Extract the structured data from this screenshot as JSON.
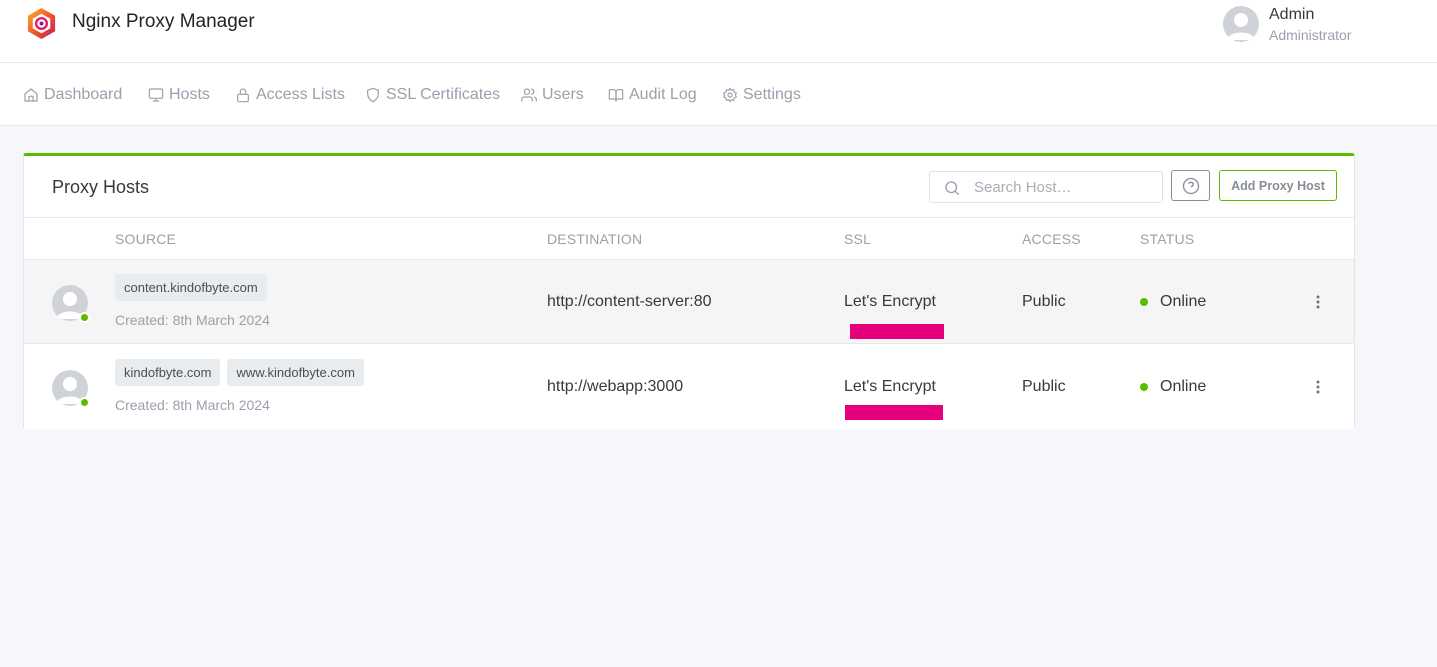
{
  "header": {
    "app_title": "Nginx Proxy Manager",
    "logo_icon": "nginx-proxy-manager-logo",
    "user": {
      "name": "Admin",
      "role": "Administrator"
    }
  },
  "nav": {
    "items": [
      {
        "label": "Dashboard",
        "icon": "home-icon"
      },
      {
        "label": "Hosts",
        "icon": "monitor-icon"
      },
      {
        "label": "Access Lists",
        "icon": "lock-icon"
      },
      {
        "label": "SSL Certificates",
        "icon": "shield-icon"
      },
      {
        "label": "Users",
        "icon": "users-icon"
      },
      {
        "label": "Audit Log",
        "icon": "book-icon"
      },
      {
        "label": "Settings",
        "icon": "gear-icon"
      }
    ]
  },
  "card": {
    "title": "Proxy Hosts",
    "search_placeholder": "Search Host…",
    "add_button": "Add Proxy Host",
    "accent_color": "#5eba00",
    "columns": [
      "SOURCE",
      "DESTINATION",
      "SSL",
      "ACCESS",
      "STATUS"
    ],
    "rows": [
      {
        "domains": [
          "content.kindofbyte.com"
        ],
        "created": "Created: 8th March 2024",
        "destination": "http://content-server:80",
        "ssl": "Let's Encrypt",
        "access": "Public",
        "status": "Online"
      },
      {
        "domains": [
          "kindofbyte.com",
          "www.kindofbyte.com"
        ],
        "created": "Created: 8th March 2024",
        "destination": "http://webapp:3000",
        "ssl": "Let's Encrypt",
        "access": "Public",
        "status": "Online"
      }
    ]
  },
  "colors": {
    "online": "#5eba00",
    "redaction": "#e6007e"
  }
}
